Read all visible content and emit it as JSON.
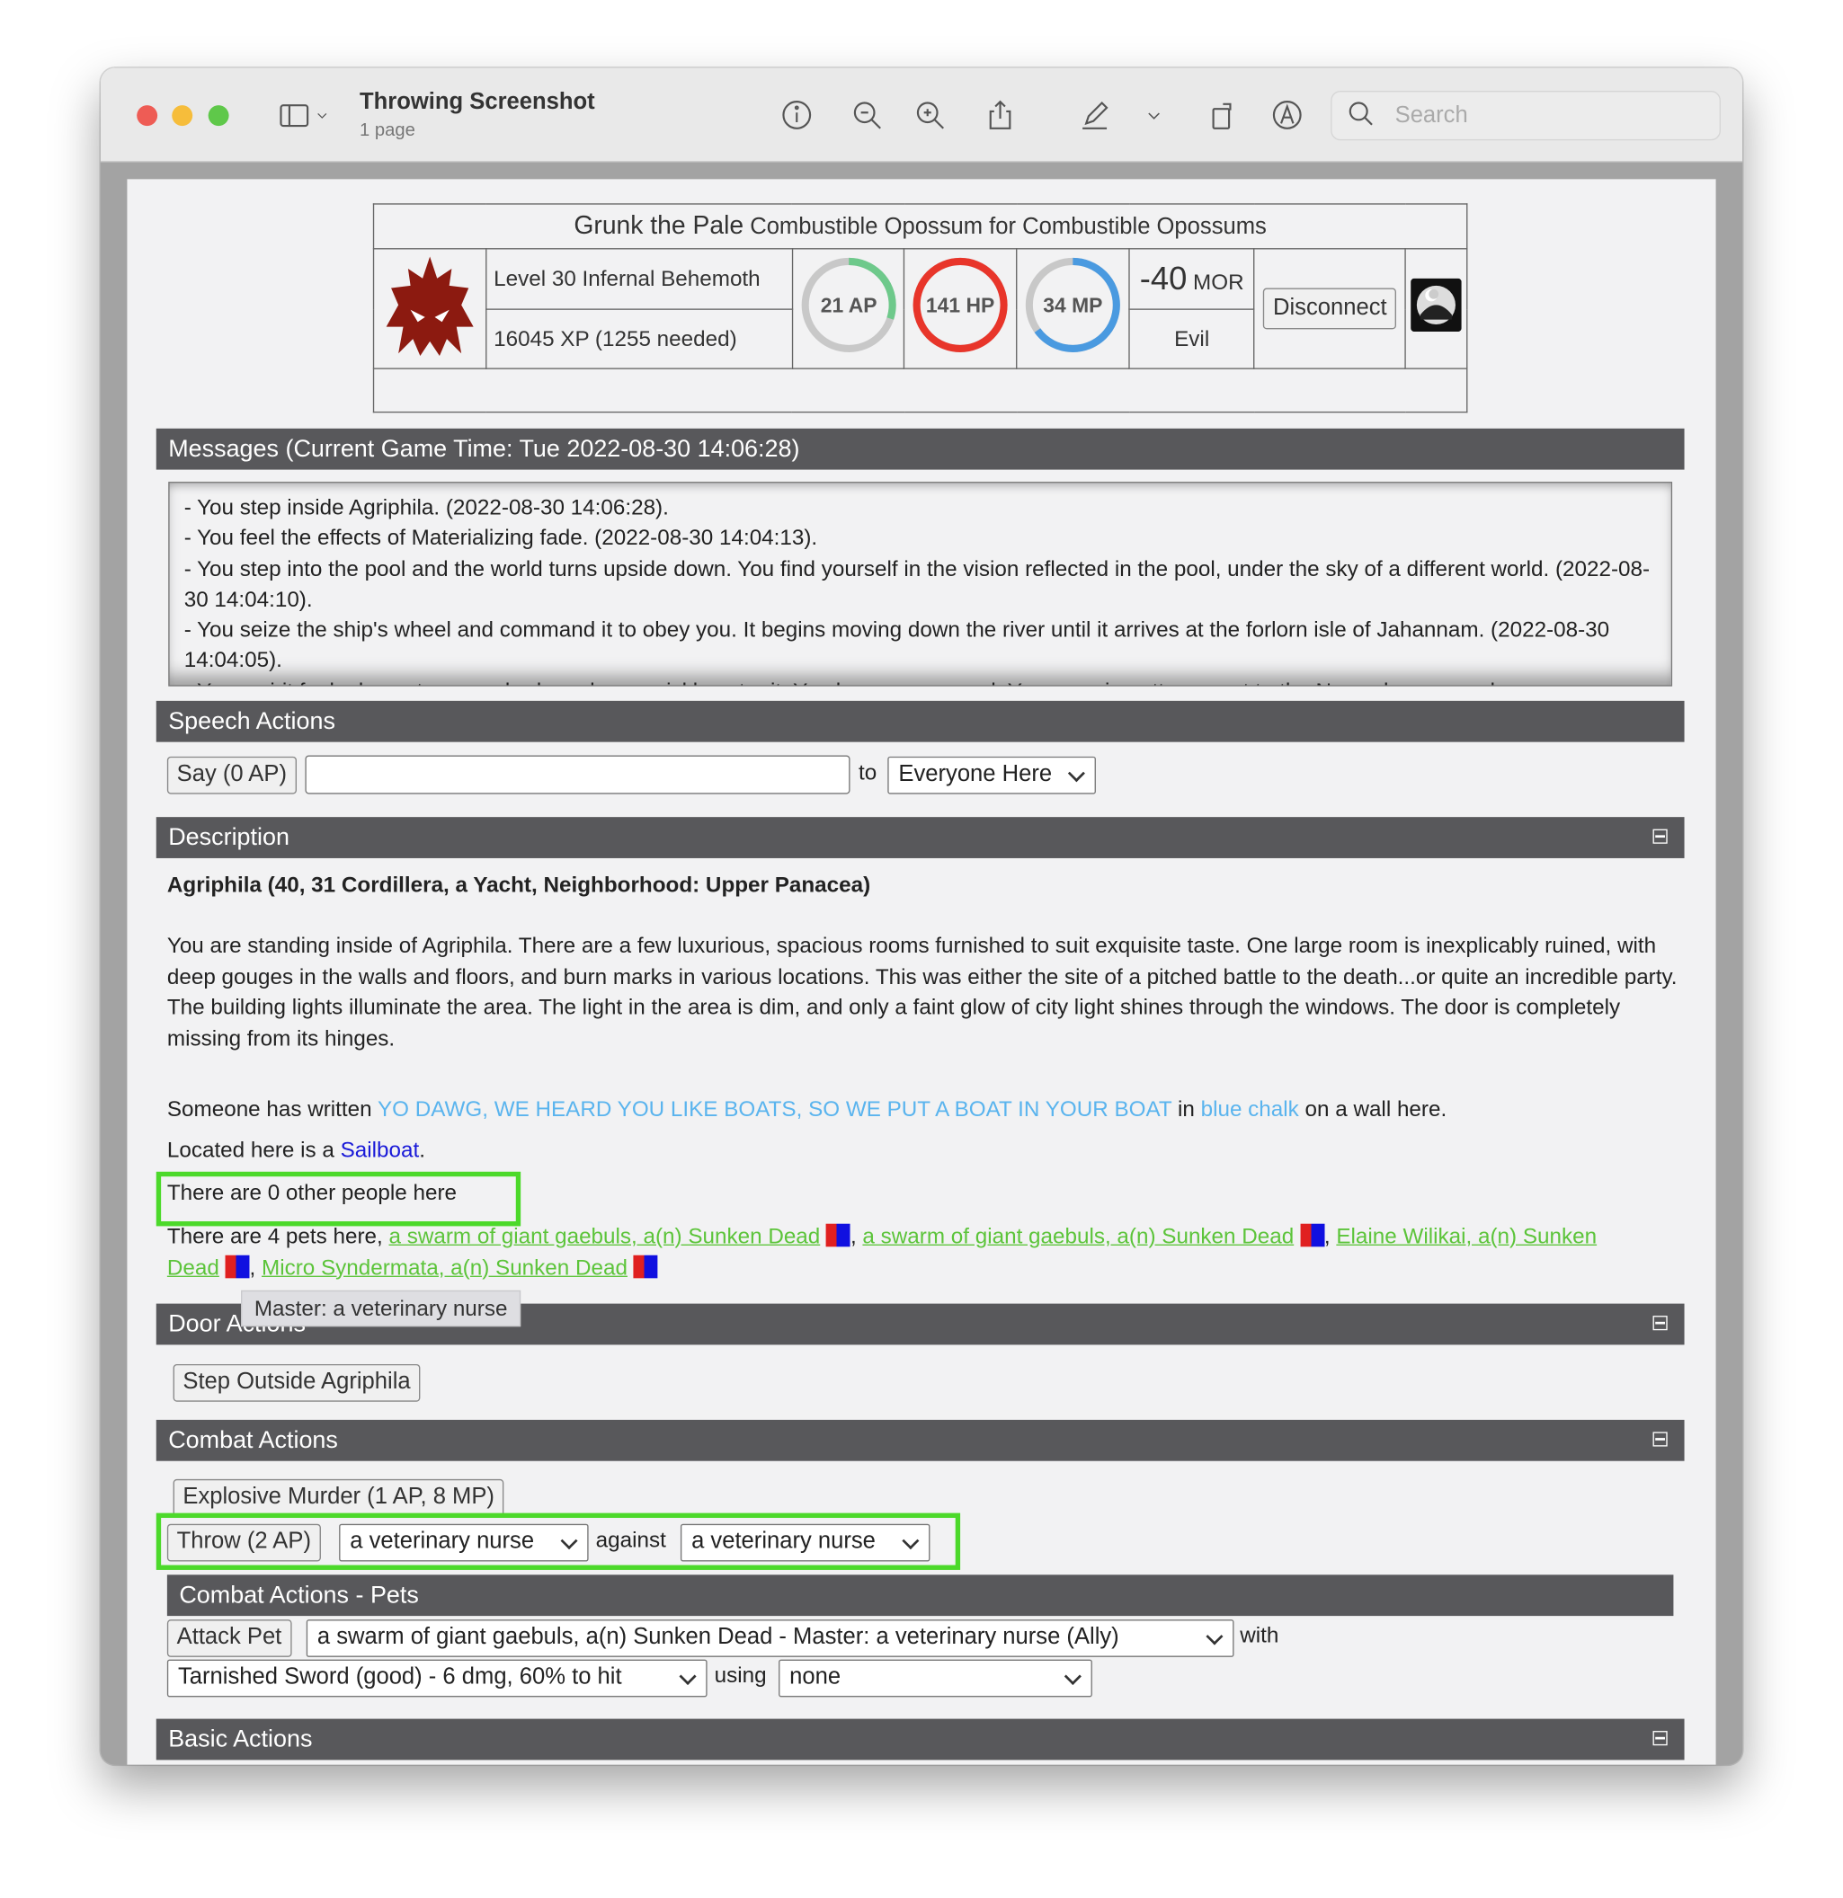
{
  "window": {
    "title": "Throwing Screenshot",
    "subtitle": "1 page",
    "search_placeholder": "Search"
  },
  "toolbar_icons": [
    "sidebar-toggle-icon",
    "info-icon",
    "zoom-out-icon",
    "zoom-in-icon",
    "share-icon",
    "markup-pen-icon",
    "rotate-icon",
    "annotate-icon",
    "search-icon"
  ],
  "character": {
    "name": "Grunk the Pale",
    "faction_role": "Combustible Opossum for",
    "faction": "Combustible Opossums",
    "level": "Level 30 Infernal Behemoth",
    "xp": "16045 XP (1255 needed)",
    "ap": {
      "label": "21 AP",
      "fill": 0.3,
      "color": "#6ec98b"
    },
    "hp": {
      "label": "141 HP",
      "fill": 1.0,
      "color": "#e8352a"
    },
    "mp": {
      "label": "34 MP",
      "fill": 0.65,
      "color": "#4a9ae0"
    },
    "morality_value": "-40",
    "morality_unit": "MOR",
    "alignment": "Evil",
    "disconnect": "Disconnect"
  },
  "messages": {
    "header": "Messages (Current Game Time: Tue 2022-08-30 14:06:28)",
    "items": [
      "- You step inside Agriphila. (2022-08-30 14:06:28).",
      "- You feel the effects of Materializing fade. (2022-08-30 14:04:13).",
      "- You step into the pool and the world turns upside down. You find yourself in the vision reflected in the pool, under the sky of a different world. (2022-08-30 14:04:10).",
      "- You seize the ship's wheel and command it to obey you. It begins moving down the river until it arrives at the forlorn isle of Jahannam. (2022-08-30 14:04:05).",
      "- Your spirit feels drawn to a new body and you quickly enter it. You have respawned. Your growing attunement to the Nexus has caused"
    ]
  },
  "speech": {
    "header": "Speech Actions",
    "say": "Say (0 AP)",
    "say_value": "",
    "to": "to",
    "target": "Everyone Here"
  },
  "description": {
    "header": "Description",
    "loc_pre": "Agriphila (40, 31 Cordillera, a ",
    "loc_link": "Yacht",
    "loc_post": ", Neighborhood: Upper Panacea)",
    "body": "You are standing inside of Agriphila. There are a few luxurious, spacious rooms furnished to suit exquisite taste. One large room is inexplicably ruined, with deep gouges in the walls and floors, and burn marks in various locations. This was either the site of a pitched battle to the death...or quite an incredible party. The building lights illuminate the area. The light in the area is dim, and only a faint glow of city light shines through the windows. The door is completely missing from its hinges.",
    "written_pre": "Someone has written ",
    "written_text": "YO DAWG, WE HEARD YOU LIKE BOATS, SO WE PUT A BOAT IN YOUR BOAT",
    "written_mid": " in ",
    "written_chalk": "blue chalk",
    "written_post": " on a wall here.",
    "located_pre": "Located here is a ",
    "located_link": "Sailboat",
    "people": "There are 0 other people here",
    "pets_pre": "There are 4 pets here, ",
    "pets": [
      "a swarm of giant gaebuls, a(n) Sunken Dead",
      "a swarm of giant gaebuls, a(n) Sunken Dead",
      "Elaine Wilikai, a(n) Sunken Dead",
      "Micro Syndermata, a(n) Sunken Dead"
    ],
    "tooltip": "Master: a veterinary nurse"
  },
  "door": {
    "header": "Door Actions",
    "step_outside": "Step Outside Agriphila"
  },
  "combat": {
    "header": "Combat Actions",
    "explosive": "Explosive Murder (1 AP, 8 MP)",
    "throw": "Throw (2 AP)",
    "throw_item": "a veterinary nurse",
    "against": "against",
    "throw_target": "a veterinary nurse"
  },
  "pets_combat": {
    "header": "Combat Actions - Pets",
    "attack": "Attack Pet",
    "pet_target": "a swarm of giant gaebuls, a(n) Sunken Dead - Master: a veterinary nurse (Ally)",
    "with": "with",
    "weapon": "Tarnished Sword (good) - 6 dmg, 60% to hit",
    "using": "using",
    "using_value": "none"
  },
  "basic": {
    "header": "Basic Actions"
  }
}
